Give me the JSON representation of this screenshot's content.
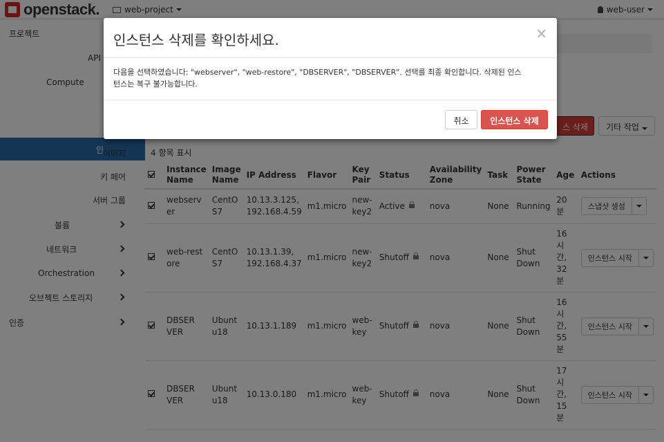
{
  "header": {
    "logo_text": "openstack.",
    "project": "web-project",
    "user": "web-user"
  },
  "sidebar": {
    "project": "프로젝트",
    "api": "API",
    "compute": "Compute",
    "instances_partial": "인",
    "images": "이미지",
    "keypairs": "키 페어",
    "server_groups": "서버 그룹",
    "volumes": "볼륨",
    "network": "네트워크",
    "orchestration": "Orchestration",
    "object_storage": "오브젝트 스토리지",
    "identity": "인증"
  },
  "toolbar": {
    "delete_partial": "스 삭제",
    "more_actions": "기타 작업"
  },
  "table": {
    "count_label": "4 항목 표시",
    "columns": {
      "name": [
        "Instance",
        "Name"
      ],
      "image": [
        "Image",
        "Name"
      ],
      "ip": "IP Address",
      "flavor": "Flavor",
      "keypair": [
        "Key",
        "Pair"
      ],
      "status": "Status",
      "zone": [
        "Availability",
        "Zone"
      ],
      "task": "Task",
      "power": [
        "Power",
        "State"
      ],
      "age": "Age",
      "actions": "Actions"
    },
    "rows": [
      {
        "name": [
          "webserv",
          "er"
        ],
        "image": [
          "CentO",
          "S7"
        ],
        "ip": [
          "10.13.3.125,",
          "192.168.4.59"
        ],
        "flavor": "m1.micro",
        "keypair": [
          "new-",
          "key2"
        ],
        "status": "Active",
        "zone": "nova",
        "task": "None",
        "power": [
          "Running"
        ],
        "age": [
          "20",
          "분"
        ],
        "action": "스냅샷 생성"
      },
      {
        "name": [
          "web-rest",
          "ore"
        ],
        "image": [
          "CentO",
          "S7"
        ],
        "ip": [
          "10.13.1.39,",
          "192.168.4.37"
        ],
        "flavor": "m1.micro",
        "keypair": [
          "new-",
          "key2"
        ],
        "status": "Shutoff",
        "zone": "nova",
        "task": "None",
        "power": [
          "Shut",
          "Down"
        ],
        "age": [
          "16",
          "시",
          "간,",
          "32",
          "분"
        ],
        "action": "인스턴스 시작"
      },
      {
        "name": [
          "DBSER",
          "VER"
        ],
        "image": [
          "Ubunt",
          "u18"
        ],
        "ip": [
          "10.13.1.189"
        ],
        "flavor": "m1.micro",
        "keypair": [
          "web-",
          "key"
        ],
        "status": "Shutoff",
        "zone": "nova",
        "task": "None",
        "power": [
          "Shut",
          "Down"
        ],
        "age": [
          "16",
          "시",
          "간,",
          "55",
          "분"
        ],
        "action": "인스턴스 시작"
      },
      {
        "name": [
          "DBSER",
          "VER"
        ],
        "image": [
          "Ubunt",
          "u18"
        ],
        "ip": [
          "10.13.0.180"
        ],
        "flavor": "m1.micro",
        "keypair": [
          "web-",
          "key"
        ],
        "status": "Shutoff",
        "zone": "nova",
        "task": "None",
        "power": [
          "Shut",
          "Down"
        ],
        "age": [
          "17",
          "시",
          "간,",
          "15",
          "분"
        ],
        "action": "인스턴스 시작"
      }
    ]
  },
  "modal": {
    "title": "인스턴스 삭제를 확인하세요.",
    "close": "×",
    "body_line1": "다음을 선택하였습니다: \"webserver\", \"web-restore\", \"DBSERVER\", \"DBSERVER\". 선택를 최종 확인합니다. 삭제된 인스",
    "body_line2": "턴스는 복구 불가능합니다.",
    "cancel": "취소",
    "confirm": "인스턴스 삭제"
  },
  "colors": {
    "accent": "#2a6ba8",
    "danger": "#d9534f"
  }
}
